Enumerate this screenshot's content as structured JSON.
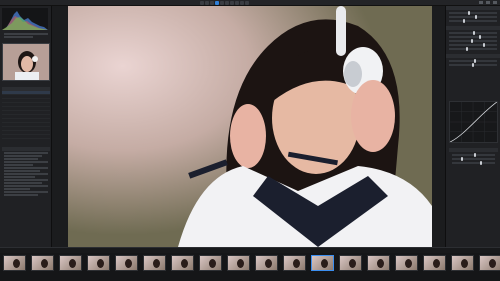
{
  "app": {
    "title": ""
  },
  "filmstrip": {
    "count": 18
  }
}
